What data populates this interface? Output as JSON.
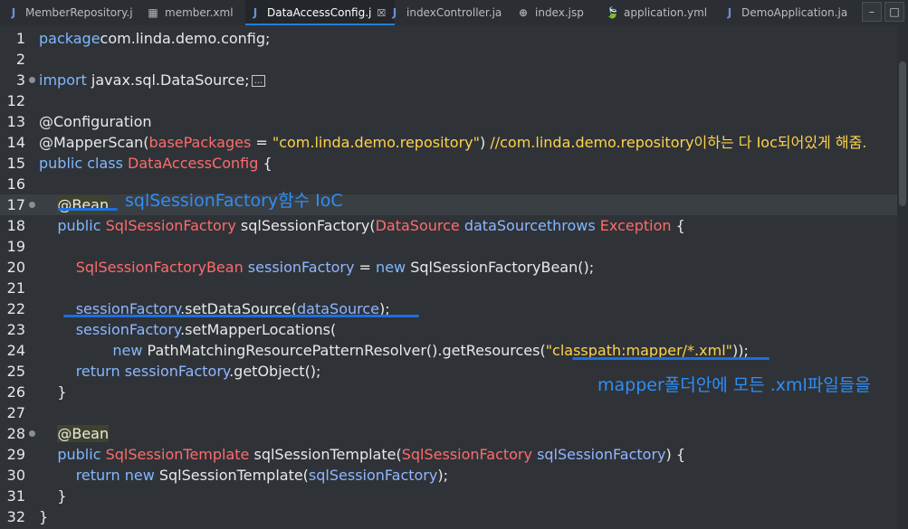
{
  "tabs": [
    {
      "icon": "J",
      "label": "MemberRepository.j",
      "active": false
    },
    {
      "icon": "▦",
      "label": "member.xml",
      "active": false
    },
    {
      "icon": "J",
      "label": "DataAccessConfig.j",
      "active": true,
      "close": "☒"
    },
    {
      "icon": "J",
      "label": "indexController.ja",
      "active": false
    },
    {
      "icon": "⊕",
      "label": "index.jsp",
      "active": false
    },
    {
      "icon": "🍃",
      "label": "application.yml",
      "active": false
    },
    {
      "icon": "J",
      "label": "DemoApplication.ja",
      "active": false
    }
  ],
  "window_buttons": {
    "minimize": "–",
    "maximize": "□"
  },
  "lines": [
    {
      "n": "1",
      "c": [
        [
          "kw",
          "package"
        ],
        [
          "",
          "com.linda.demo.config;"
        ]
      ]
    },
    {
      "n": "2",
      "c": []
    },
    {
      "n": "3",
      "fold": true,
      "c": [
        [
          "kw",
          "import"
        ],
        [
          "",
          " javax.sql.DataSource;"
        ]
      ],
      "ellipsis": "..."
    },
    {
      "n": "12",
      "c": []
    },
    {
      "n": "13",
      "c": [
        [
          "",
          "@Configuration"
        ]
      ]
    },
    {
      "n": "14",
      "c": [
        [
          "",
          "@MapperScan("
        ],
        [
          "param",
          "basePackages"
        ],
        [
          "",
          " = "
        ],
        [
          "str",
          "\"com.linda.demo.repository\""
        ],
        [
          "",
          ")"
        ],
        [
          "cmt",
          " //com.linda.demo.repository이하는 다 Ioc되어있게 해줌."
        ]
      ]
    },
    {
      "n": "15",
      "c": [
        [
          "kw",
          "public class"
        ],
        [
          "",
          " "
        ],
        [
          "ty",
          "DataAccessConfig"
        ],
        [
          "",
          " {"
        ]
      ]
    },
    {
      "n": "16",
      "c": []
    },
    {
      "n": "17",
      "fold": true,
      "current": true,
      "c": [
        [
          "",
          "    "
        ],
        [
          "beanbg",
          "@Bean"
        ]
      ]
    },
    {
      "n": "18",
      "c": [
        [
          "",
          "    "
        ],
        [
          "kw",
          "public"
        ],
        [
          "",
          " "
        ],
        [
          "ty",
          "SqlSessionFactory"
        ],
        [
          "",
          " sqlSessionFactory("
        ],
        [
          "ty",
          "DataSource"
        ],
        [
          "",
          " "
        ],
        [
          "var",
          "dataSource"
        ],
        [
          ") "
        ],
        [
          "kw",
          "throws"
        ],
        [
          "",
          " "
        ],
        [
          "ty",
          "Exception"
        ],
        [
          "",
          " {"
        ]
      ]
    },
    {
      "n": "19",
      "c": []
    },
    {
      "n": "20",
      "c": [
        [
          "",
          "        "
        ],
        [
          "ty",
          "SqlSessionFactoryBean"
        ],
        [
          "",
          " "
        ],
        [
          "var",
          "sessionFactory"
        ],
        [
          "",
          " = "
        ],
        [
          "kw",
          "new"
        ],
        [
          "",
          " SqlSessionFactoryBean();"
        ]
      ]
    },
    {
      "n": "21",
      "c": []
    },
    {
      "n": "22",
      "c": [
        [
          "",
          "        "
        ],
        [
          "var",
          "sessionFactory"
        ],
        [
          "",
          ".setDataSource("
        ],
        [
          "var",
          "dataSource"
        ],
        [
          "",
          ");"
        ]
      ]
    },
    {
      "n": "23",
      "c": [
        [
          "",
          "        "
        ],
        [
          "var",
          "sessionFactory"
        ],
        [
          "",
          ".setMapperLocations("
        ]
      ]
    },
    {
      "n": "24",
      "c": [
        [
          "",
          "                "
        ],
        [
          "kw",
          "new"
        ],
        [
          "",
          " PathMatchingResourcePatternResolver().getResources("
        ],
        [
          "str",
          "\"classpath:mapper/*.xml\""
        ],
        [
          "",
          "));"
        ]
      ]
    },
    {
      "n": "25",
      "c": [
        [
          "",
          "        "
        ],
        [
          "kw",
          "return"
        ],
        [
          "",
          " "
        ],
        [
          "var",
          "sessionFactory"
        ],
        [
          "",
          ".getObject();"
        ]
      ]
    },
    {
      "n": "26",
      "c": [
        [
          "",
          "    }"
        ]
      ]
    },
    {
      "n": "27",
      "c": []
    },
    {
      "n": "28",
      "fold": true,
      "c": [
        [
          "",
          "    "
        ],
        [
          "beanbg",
          "@Bean"
        ]
      ]
    },
    {
      "n": "29",
      "c": [
        [
          "",
          "    "
        ],
        [
          "kw",
          "public"
        ],
        [
          "",
          " "
        ],
        [
          "ty",
          "SqlSessionTemplate"
        ],
        [
          "",
          " sqlSessionTemplate("
        ],
        [
          "ty",
          "SqlSessionFactory"
        ],
        [
          "",
          " "
        ],
        [
          "var",
          "sqlSessionFactory"
        ],
        [
          "",
          ") {"
        ]
      ]
    },
    {
      "n": "30",
      "c": [
        [
          "",
          "        "
        ],
        [
          "kw",
          "return"
        ],
        [
          "",
          " "
        ],
        [
          "kw",
          "new"
        ],
        [
          "",
          " SqlSessionTemplate("
        ],
        [
          "var",
          "sqlSessionFactory"
        ],
        [
          "",
          ");"
        ]
      ]
    },
    {
      "n": "31",
      "c": [
        [
          "",
          "    }"
        ]
      ]
    },
    {
      "n": "32",
      "c": [
        [
          "",
          "}"
        ]
      ]
    }
  ],
  "annotations": {
    "bean_note": "sqlSessionFactory함수 IoC",
    "mapper_note": "mapper폴더안에  모든 .xml파일들을"
  },
  "colors": {
    "keyword": "#81b7ff",
    "type": "#ff6b6b",
    "string": "#ffd24a",
    "annotation_ink": "#2f8ef5",
    "background": "#2f3338"
  }
}
